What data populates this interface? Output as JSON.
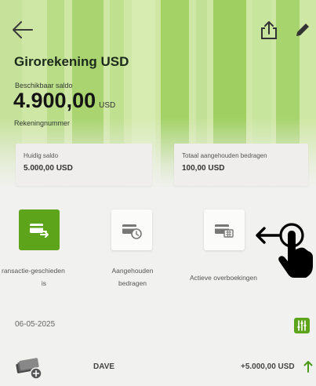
{
  "header": {
    "account_title": "Girorekening USD",
    "balance_label": "Beschikbaar saldo",
    "balance_amount": "4.900,00",
    "balance_currency": "USD",
    "account_number_label": "Rekeningnummer"
  },
  "cards": [
    {
      "label": "Huidig saldo",
      "value": "5.000,00 USD"
    },
    {
      "label": "Totaal aangehouden bedragen",
      "value": "100,00 USD"
    }
  ],
  "actions": [
    {
      "label_line1": "ransactie-geschieden",
      "label_line2": "is",
      "icon": "transfer-history-icon"
    },
    {
      "label_line1": "Aangehouden",
      "label_line2": "bedragen",
      "icon": "held-amounts-icon"
    },
    {
      "label_line1": "Actieve overboekingen",
      "icon": "active-transfers-icon"
    }
  ],
  "transactions": {
    "date": "06-05-2025",
    "items": [
      {
        "name": "DAVE",
        "amount": "+5.000,00 USD",
        "direction": "incoming"
      }
    ]
  },
  "colors": {
    "accent": "#5ea41b",
    "header_bg": "#cfe7a4",
    "page_bg": "#f1f1ef"
  },
  "icons": [
    "back-arrow-icon",
    "share-icon",
    "edit-pencil-icon",
    "filter-icon",
    "hand-pointer-icon",
    "arrow-up-icon"
  ]
}
